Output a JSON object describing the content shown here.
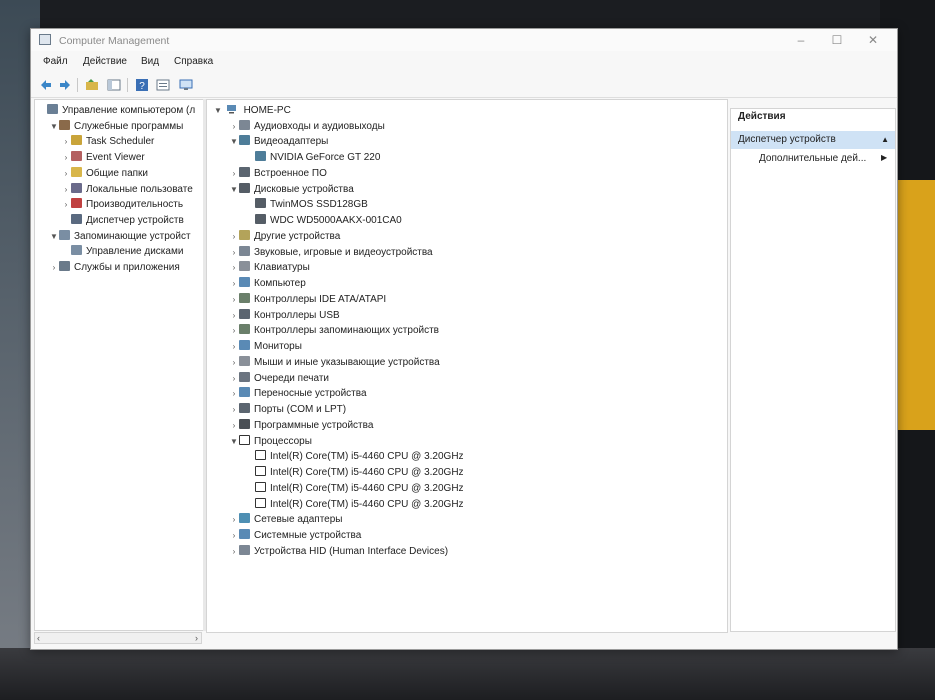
{
  "window": {
    "title": "Computer Management"
  },
  "menu": [
    "Файл",
    "Действие",
    "Вид",
    "Справка"
  ],
  "tree": [
    {
      "label": "Управление компьютером (л",
      "indent": 0,
      "expander": "",
      "icon": "computer-management-icon",
      "color": "#6a7f95"
    },
    {
      "label": "Служебные программы",
      "indent": 1,
      "expander": "▼",
      "icon": "tools-icon",
      "color": "#8a6a4a"
    },
    {
      "label": "Task Scheduler",
      "indent": 2,
      "expander": "›",
      "icon": "clock-icon",
      "color": "#c9a43a"
    },
    {
      "label": "Event Viewer",
      "indent": 2,
      "expander": "›",
      "icon": "event-viewer-icon",
      "color": "#b46060"
    },
    {
      "label": "Общие папки",
      "indent": 2,
      "expander": "›",
      "icon": "shared-folder-icon",
      "color": "#d8b64a"
    },
    {
      "label": "Локальные пользовате",
      "indent": 2,
      "expander": "›",
      "icon": "users-icon",
      "color": "#6a6a8a"
    },
    {
      "label": "Производительность",
      "indent": 2,
      "expander": "›",
      "icon": "performance-icon",
      "color": "#c04040"
    },
    {
      "label": "Диспетчер устройств",
      "indent": 2,
      "expander": "",
      "icon": "device-manager-icon",
      "color": "#5a6a80"
    },
    {
      "label": "Запоминающие устройст",
      "indent": 1,
      "expander": "▼",
      "icon": "storage-icon",
      "color": "#7a8ea3"
    },
    {
      "label": "Управление дисками",
      "indent": 2,
      "expander": "",
      "icon": "disk-management-icon",
      "color": "#7a8ea3"
    },
    {
      "label": "Службы и приложения",
      "indent": 1,
      "expander": "›",
      "icon": "services-icon",
      "color": "#6a7a8a"
    }
  ],
  "devices": {
    "root": "HOME-PC",
    "items": [
      {
        "label": "Аудиовходы и аудиовыходы",
        "level": 1,
        "expander": "›",
        "icon": "audio-icon",
        "color": "#7c8794"
      },
      {
        "label": "Видеоадаптеры",
        "level": 1,
        "expander": "▼",
        "icon": "display-adapter-icon",
        "color": "#4e7d99"
      },
      {
        "label": "NVIDIA GeForce GT 220",
        "level": 2,
        "expander": "",
        "icon": "display-adapter-icon",
        "color": "#4e7d99"
      },
      {
        "label": "Встроенное ПО",
        "level": 1,
        "expander": "›",
        "icon": "firmware-icon",
        "color": "#5b6570"
      },
      {
        "label": "Дисковые устройства",
        "level": 1,
        "expander": "▼",
        "icon": "disk-drive-icon",
        "color": "#555d66"
      },
      {
        "label": "TwinMOS SSD128GB",
        "level": 2,
        "expander": "",
        "icon": "disk-drive-icon",
        "color": "#555d66"
      },
      {
        "label": "WDC WD5000AAKX-001CA0",
        "level": 2,
        "expander": "",
        "icon": "disk-drive-icon",
        "color": "#555d66"
      },
      {
        "label": "Другие устройства",
        "level": 1,
        "expander": "›",
        "icon": "other-devices-icon",
        "color": "#b3a35a"
      },
      {
        "label": "Звуковые, игровые и видеоустройства",
        "level": 1,
        "expander": "›",
        "icon": "sound-icon",
        "color": "#7c8794"
      },
      {
        "label": "Клавиатуры",
        "level": 1,
        "expander": "›",
        "icon": "keyboard-icon",
        "color": "#8a9099"
      },
      {
        "label": "Компьютер",
        "level": 1,
        "expander": "›",
        "icon": "computer-icon",
        "color": "#5a8ab5"
      },
      {
        "label": "Контроллеры IDE ATA/ATAPI",
        "level": 1,
        "expander": "›",
        "icon": "ide-controller-icon",
        "color": "#6a7f6a"
      },
      {
        "label": "Контроллеры USB",
        "level": 1,
        "expander": "›",
        "icon": "usb-icon",
        "color": "#5b6570"
      },
      {
        "label": "Контроллеры запоминающих устройств",
        "level": 1,
        "expander": "›",
        "icon": "storage-controller-icon",
        "color": "#6a7f6a"
      },
      {
        "label": "Мониторы",
        "level": 1,
        "expander": "›",
        "icon": "monitor-icon",
        "color": "#5a8ab5"
      },
      {
        "label": "Мыши и иные указывающие устройства",
        "level": 1,
        "expander": "›",
        "icon": "mouse-icon",
        "color": "#8a9099"
      },
      {
        "label": "Очереди печати",
        "level": 1,
        "expander": "›",
        "icon": "print-queue-icon",
        "color": "#6b7480"
      },
      {
        "label": "Переносные устройства",
        "level": 1,
        "expander": "›",
        "icon": "portable-device-icon",
        "color": "#5a8ab5"
      },
      {
        "label": "Порты (COM и LPT)",
        "level": 1,
        "expander": "›",
        "icon": "port-icon",
        "color": "#5b6570"
      },
      {
        "label": "Программные устройства",
        "level": 1,
        "expander": "›",
        "icon": "software-device-icon",
        "color": "#4a4f55"
      },
      {
        "label": "Процессоры",
        "level": 1,
        "expander": "▼",
        "icon": "processor-icon",
        "color": "#333333"
      },
      {
        "label": "Intel(R) Core(TM) i5-4460  CPU @ 3.20GHz",
        "level": 2,
        "expander": "",
        "icon": "processor-icon",
        "color": "#333333"
      },
      {
        "label": "Intel(R) Core(TM) i5-4460  CPU @ 3.20GHz",
        "level": 2,
        "expander": "",
        "icon": "processor-icon",
        "color": "#333333"
      },
      {
        "label": "Intel(R) Core(TM) i5-4460  CPU @ 3.20GHz",
        "level": 2,
        "expander": "",
        "icon": "processor-icon",
        "color": "#333333"
      },
      {
        "label": "Intel(R) Core(TM) i5-4460  CPU @ 3.20GHz",
        "level": 2,
        "expander": "",
        "icon": "processor-icon",
        "color": "#333333"
      },
      {
        "label": "Сетевые адаптеры",
        "level": 1,
        "expander": "›",
        "icon": "network-adapter-icon",
        "color": "#4e8fb3"
      },
      {
        "label": "Системные устройства",
        "level": 1,
        "expander": "›",
        "icon": "system-device-icon",
        "color": "#5a8ab5"
      },
      {
        "label": "Устройства HID (Human Interface Devices)",
        "level": 1,
        "expander": "›",
        "icon": "hid-icon",
        "color": "#7c8794"
      }
    ]
  },
  "actions": {
    "header": "Действия",
    "section": "Диспетчер устройств",
    "more": "Дополнительные дей..."
  }
}
